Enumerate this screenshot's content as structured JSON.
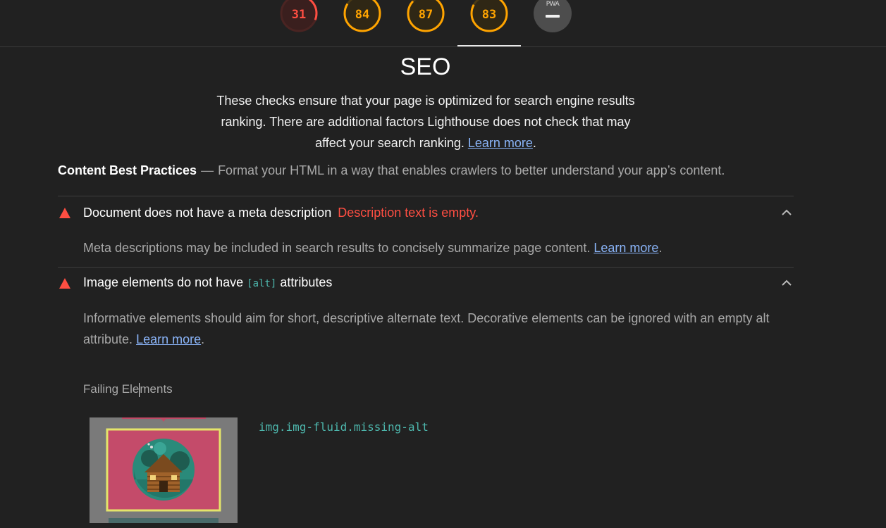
{
  "scores": [
    {
      "name": "performance",
      "value": "31",
      "fraction": 0.31,
      "color": "#ff4e42",
      "bg": "#3a1f1e",
      "track": "#4a2422"
    },
    {
      "name": "accessibility",
      "value": "84",
      "fraction": 0.84,
      "color": "#ffa400",
      "bg": "#2f2715",
      "track": "#4a3a15"
    },
    {
      "name": "best-practices",
      "value": "87",
      "fraction": 0.87,
      "color": "#ffa400",
      "bg": "#2f2715",
      "track": "#4a3a15"
    },
    {
      "name": "seo",
      "value": "83",
      "fraction": 0.83,
      "color": "#ffa400",
      "bg": "#2f2715",
      "track": "#4a3a15"
    }
  ],
  "pwa": {
    "label": "PWA"
  },
  "category": {
    "title": "SEO",
    "description": "These checks ensure that your page is optimized for search engine results ranking. There are additional factors Lighthouse does not check that may affect your search ranking.",
    "learn_more": "Learn more",
    "period": "."
  },
  "group": {
    "title": "Content Best Practices",
    "separator": "—",
    "description": "Format your HTML in a way that enables crawlers to better understand your app’s content."
  },
  "audits": [
    {
      "title": "Document does not have a meta description",
      "display_value": "Description text is empty.",
      "description": "Meta descriptions may be included in search results to concisely summarize page content.",
      "learn_more": "Learn more",
      "period": "."
    },
    {
      "title_prefix": "Image elements do not have",
      "code": "[alt]",
      "title_suffix": "attributes",
      "description": "Informative elements should aim for short, descriptive alternate text. Decorative elements can be ignored with an empty alt attribute.",
      "learn_more": "Learn more",
      "period": ".",
      "failing_label_a": "Failing Ele",
      "failing_label_b": "ments",
      "selector": "img.img-fluid.missing-alt"
    }
  ]
}
